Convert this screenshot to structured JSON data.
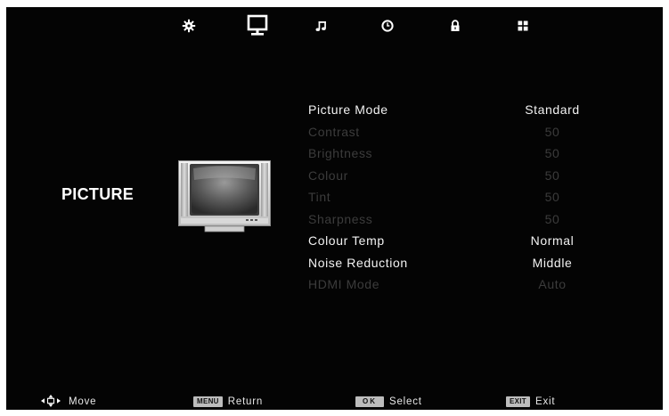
{
  "tabs": [
    {
      "name": "setup-tab",
      "icon": "gear-icon",
      "active": false
    },
    {
      "name": "picture-tab",
      "icon": "monitor-icon",
      "active": true
    },
    {
      "name": "sound-tab",
      "icon": "music-note-icon",
      "active": false
    },
    {
      "name": "time-tab",
      "icon": "clock-icon",
      "active": false
    },
    {
      "name": "lock-tab",
      "icon": "lock-icon",
      "active": false
    },
    {
      "name": "channel-tab",
      "icon": "grid-icon",
      "active": false
    }
  ],
  "section": {
    "title": "PICTURE",
    "image": "tv-icon"
  },
  "menu": {
    "items": [
      {
        "label": "Picture Mode",
        "value": "Standard",
        "enabled": true
      },
      {
        "label": "Contrast",
        "value": "50",
        "enabled": false
      },
      {
        "label": "Brightness",
        "value": "50",
        "enabled": false
      },
      {
        "label": "Colour",
        "value": "50",
        "enabled": false
      },
      {
        "label": "Tint",
        "value": "50",
        "enabled": false
      },
      {
        "label": "Sharpness",
        "value": "50",
        "enabled": false
      },
      {
        "label": "Colour Temp",
        "value": "Normal",
        "enabled": true
      },
      {
        "label": "Noise Reduction",
        "value": "Middle",
        "enabled": true
      },
      {
        "label": "HDMI Mode",
        "value": "Auto",
        "enabled": false
      }
    ]
  },
  "hints": {
    "move": {
      "icon": "arrows-icon",
      "label": "Move"
    },
    "return": {
      "key": "MENU",
      "label": "Return"
    },
    "select": {
      "key": "OK",
      "label": "Select"
    },
    "exit": {
      "key": "EXIT",
      "label": "Exit"
    }
  },
  "colors": {
    "background": "#040404",
    "text_enabled": "#f2f2f2",
    "text_disabled": "#3c3c3c",
    "keycap": "#bdbdbd"
  }
}
